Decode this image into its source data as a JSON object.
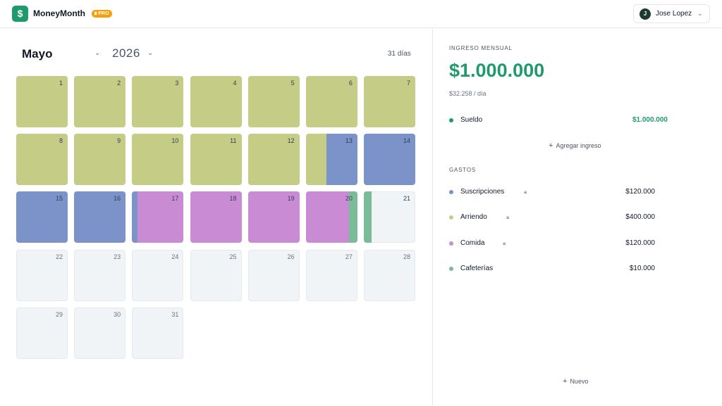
{
  "app": {
    "title": "MoneyMonth",
    "badge": "PRO",
    "logo_symbol": "$",
    "brand_color": "#1f9a6d"
  },
  "user": {
    "initial": "J",
    "name": "Jose Lopez"
  },
  "calendar": {
    "month": "Mayo",
    "year": "2026",
    "days_label": "31 días",
    "days": [
      {
        "n": "1",
        "segments": [
          {
            "c": "#c5cc86",
            "f": 1
          }
        ]
      },
      {
        "n": "2",
        "segments": [
          {
            "c": "#c5cc86",
            "f": 1
          }
        ]
      },
      {
        "n": "3",
        "segments": [
          {
            "c": "#c5cc86",
            "f": 1
          }
        ]
      },
      {
        "n": "4",
        "segments": [
          {
            "c": "#c5cc86",
            "f": 1
          }
        ]
      },
      {
        "n": "5",
        "segments": [
          {
            "c": "#c5cc86",
            "f": 1
          }
        ]
      },
      {
        "n": "6",
        "segments": [
          {
            "c": "#c5cc86",
            "f": 1
          }
        ]
      },
      {
        "n": "7",
        "segments": [
          {
            "c": "#c5cc86",
            "f": 1
          }
        ]
      },
      {
        "n": "8",
        "segments": [
          {
            "c": "#c5cc86",
            "f": 1
          }
        ]
      },
      {
        "n": "9",
        "segments": [
          {
            "c": "#c5cc86",
            "f": 1
          }
        ]
      },
      {
        "n": "10",
        "segments": [
          {
            "c": "#c5cc86",
            "f": 1
          }
        ]
      },
      {
        "n": "11",
        "segments": [
          {
            "c": "#c5cc86",
            "f": 1
          }
        ]
      },
      {
        "n": "12",
        "segments": [
          {
            "c": "#c5cc86",
            "f": 1
          }
        ]
      },
      {
        "n": "13",
        "segments": [
          {
            "c": "#c5cc86",
            "f": 0.4
          },
          {
            "c": "#7b93c9",
            "f": 0.6
          }
        ]
      },
      {
        "n": "14",
        "segments": [
          {
            "c": "#7b93c9",
            "f": 1
          }
        ]
      },
      {
        "n": "15",
        "segments": [
          {
            "c": "#7b93c9",
            "f": 1
          }
        ]
      },
      {
        "n": "16",
        "segments": [
          {
            "c": "#7b93c9",
            "f": 1
          }
        ]
      },
      {
        "n": "17",
        "segments": [
          {
            "c": "#7b93c9",
            "f": 0.1
          },
          {
            "c": "#c98bd4",
            "f": 0.9
          }
        ]
      },
      {
        "n": "18",
        "segments": [
          {
            "c": "#c98bd4",
            "f": 1
          }
        ]
      },
      {
        "n": "19",
        "segments": [
          {
            "c": "#c98bd4",
            "f": 1
          }
        ]
      },
      {
        "n": "20",
        "segments": [
          {
            "c": "#c98bd4",
            "f": 0.84
          },
          {
            "c": "#78bd98",
            "f": 0.16
          }
        ]
      },
      {
        "n": "21",
        "segments": [
          {
            "c": "#78bd98",
            "f": 0.15
          }
        ]
      },
      {
        "n": "22",
        "segments": []
      },
      {
        "n": "23",
        "segments": []
      },
      {
        "n": "24",
        "segments": []
      },
      {
        "n": "25",
        "segments": []
      },
      {
        "n": "26",
        "segments": []
      },
      {
        "n": "27",
        "segments": []
      },
      {
        "n": "28",
        "segments": []
      },
      {
        "n": "29",
        "segments": []
      },
      {
        "n": "30",
        "segments": []
      },
      {
        "n": "31",
        "segments": []
      }
    ]
  },
  "income": {
    "section_label": "INGRESO MENSUAL",
    "total": "$1.000.000",
    "per_day": "$32.258 / día",
    "items": [
      {
        "label": "Sueldo",
        "amount": "$1.000.000",
        "color": "#1f9a6d"
      }
    ],
    "add_label": "Agregar ingreso"
  },
  "expenses": {
    "section_label": "GASTOS",
    "items": [
      {
        "label": "Suscripciones",
        "amount": "$120.000",
        "color": "#7b93c9",
        "locked": true
      },
      {
        "label": "Arriendo",
        "amount": "$400.000",
        "color": "#c5cc86",
        "locked": true
      },
      {
        "label": "Comida",
        "amount": "$120.000",
        "color": "#c98bd4",
        "locked": true
      },
      {
        "label": "Cafeterías",
        "amount": "$10.000",
        "color": "#78bd98",
        "locked": false
      }
    ]
  },
  "new_label": "Nuevo"
}
